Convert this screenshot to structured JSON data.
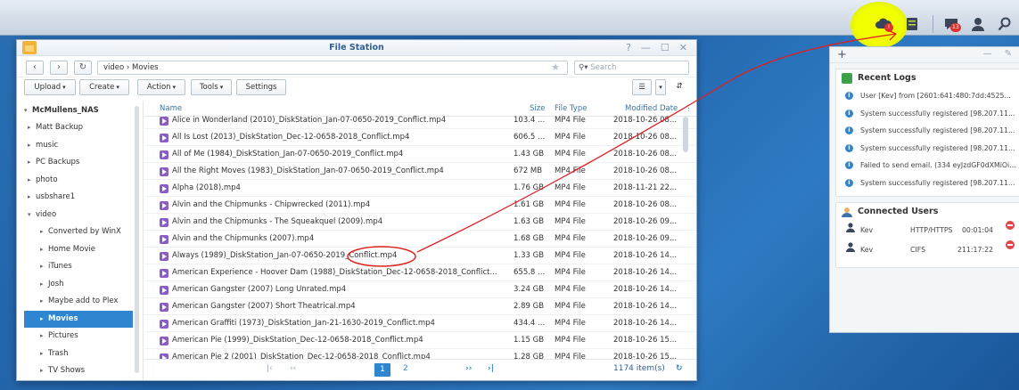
{
  "taskbar": {
    "notification_count": "13",
    "alert_badge": "!"
  },
  "window": {
    "title": "File Station",
    "controls": {
      "help": "?",
      "minimize": "—",
      "maximize": "☐",
      "close": "✕"
    }
  },
  "nav": {
    "path": "video › Movies",
    "search_placeholder": "Search"
  },
  "toolbar": {
    "upload": "Upload",
    "create": "Create",
    "action": "Action",
    "tools": "Tools",
    "settings": "Settings"
  },
  "tree": {
    "root": "McMullens_NAS",
    "items": [
      {
        "label": "Matt Backup",
        "level": 1,
        "expanded": false
      },
      {
        "label": "music",
        "level": 1,
        "expanded": false
      },
      {
        "label": "PC Backups",
        "level": 1,
        "expanded": false
      },
      {
        "label": "photo",
        "level": 1,
        "expanded": false
      },
      {
        "label": "usbshare1",
        "level": 1,
        "expanded": false
      },
      {
        "label": "video",
        "level": 1,
        "expanded": true
      },
      {
        "label": "Converted by WinX",
        "level": 2,
        "expanded": false
      },
      {
        "label": "Home Movie",
        "level": 2,
        "expanded": false
      },
      {
        "label": "iTunes",
        "level": 2,
        "expanded": false
      },
      {
        "label": "Josh",
        "level": 2,
        "expanded": false
      },
      {
        "label": "Maybe add to Plex",
        "level": 2,
        "expanded": false
      },
      {
        "label": "Movies",
        "level": 2,
        "expanded": false,
        "selected": true
      },
      {
        "label": "Pictures",
        "level": 2,
        "expanded": false
      },
      {
        "label": "Trash",
        "level": 2,
        "expanded": false
      },
      {
        "label": "TV Shows",
        "level": 2,
        "expanded": false
      }
    ]
  },
  "list": {
    "columns": {
      "name": "Name",
      "size": "Size",
      "type": "File Type",
      "modified": "Modified Date"
    },
    "rows": [
      {
        "name": "Alice in Wonderland (2010)_DiskStation_Jan-07-0650-2019_Conflict.mp4",
        "size": "103.4 ...",
        "type": "MP4 File",
        "modified": "2018-10-26 08..."
      },
      {
        "name": "All Is Lost (2013)_DiskStation_Dec-12-0658-2018_Conflict.mp4",
        "size": "606.5 ...",
        "type": "MP4 File",
        "modified": "2018-10-26 08..."
      },
      {
        "name": "All of Me (1984)_DiskStation_Jan-07-0650-2019_Conflict.mp4",
        "size": "1.43 GB",
        "type": "MP4 File",
        "modified": "2018-10-26 08..."
      },
      {
        "name": "All the Right Moves (1983)_DiskStation_Jan-07-0650-2019_Conflict.mp4",
        "size": "672 MB",
        "type": "MP4 File",
        "modified": "2018-10-26 08..."
      },
      {
        "name": "Alpha (2018).mp4",
        "size": "1.76 GB",
        "type": "MP4 File",
        "modified": "2018-11-21 22..."
      },
      {
        "name": "Alvin and the Chipmunks - Chipwrecked (2011).mp4",
        "size": "1.61 GB",
        "type": "MP4 File",
        "modified": "2018-10-26 08..."
      },
      {
        "name": "Alvin and the Chipmunks - The Squeakquel (2009).mp4",
        "size": "1.63 GB",
        "type": "MP4 File",
        "modified": "2018-10-26 09..."
      },
      {
        "name": "Alvin and the Chipmunks (2007).mp4",
        "size": "1.68 GB",
        "type": "MP4 File",
        "modified": "2018-10-26 09..."
      },
      {
        "name": "Always (1989)_DiskStation_Jan-07-0650-2019_Conflict.mp4",
        "size": "1.33 GB",
        "type": "MP4 File",
        "modified": "2018-10-26 14..."
      },
      {
        "name": "American Experience - Hoover Dam (1988)_DiskStation_Dec-12-0658-2018_Conflict...",
        "size": "655.8 ...",
        "type": "MP4 File",
        "modified": "2018-10-26 14..."
      },
      {
        "name": "American Gangster (2007) Long Unrated.mp4",
        "size": "3.24 GB",
        "type": "MP4 File",
        "modified": "2018-10-26 14..."
      },
      {
        "name": "American Gangster (2007) Short Theatrical.mp4",
        "size": "2.89 GB",
        "type": "MP4 File",
        "modified": "2018-10-26 14..."
      },
      {
        "name": "American Graffiti (1973)_DiskStation_Jan-21-1630-2019_Conflict.mp4",
        "size": "434.4 ...",
        "type": "MP4 File",
        "modified": "2018-10-26 14..."
      },
      {
        "name": "American Pie (1999)_DiskStation_Dec-12-0658-2018_Conflict.mp4",
        "size": "1.15 GB",
        "type": "MP4 File",
        "modified": "2018-10-26 15..."
      },
      {
        "name": "American Pie 2 (2001)_DiskStation_Dec-12-0658-2018_Conflict.mp4",
        "size": "1.28 GB",
        "type": "MP4 File",
        "modified": "2018-10-26 15..."
      }
    ]
  },
  "pager": {
    "first": "|‹",
    "prev": "‹‹",
    "page1": "1",
    "page2": "2",
    "next": "››",
    "last": "›|",
    "count": "1174 item(s)"
  },
  "widget": {
    "plus": "+",
    "controls": {
      "minimize": "—",
      "pin": "✎"
    },
    "logs": {
      "title": "Recent Logs",
      "items": [
        "User [Kev] from [2601:641:480:7dd:4525...",
        "System successfully registered [98.207.11...",
        "System successfully registered [98.207.11...",
        "System successfully registered [98.207.11...",
        "Failed to send email. (334 eyJzdGF0dXMiOi...",
        "System successfully registered [98.207.11..."
      ]
    },
    "users": {
      "title": "Connected Users",
      "items": [
        {
          "user": "Kev",
          "protocol": "HTTP/HTTPS",
          "time": "00:01:04"
        },
        {
          "user": "Kev",
          "protocol": "CIFS",
          "time": "211:17:22"
        }
      ]
    }
  },
  "colors": {
    "accent": "#2e86d1",
    "annotation": "#e02020",
    "highlighter": "#f2ff00"
  }
}
